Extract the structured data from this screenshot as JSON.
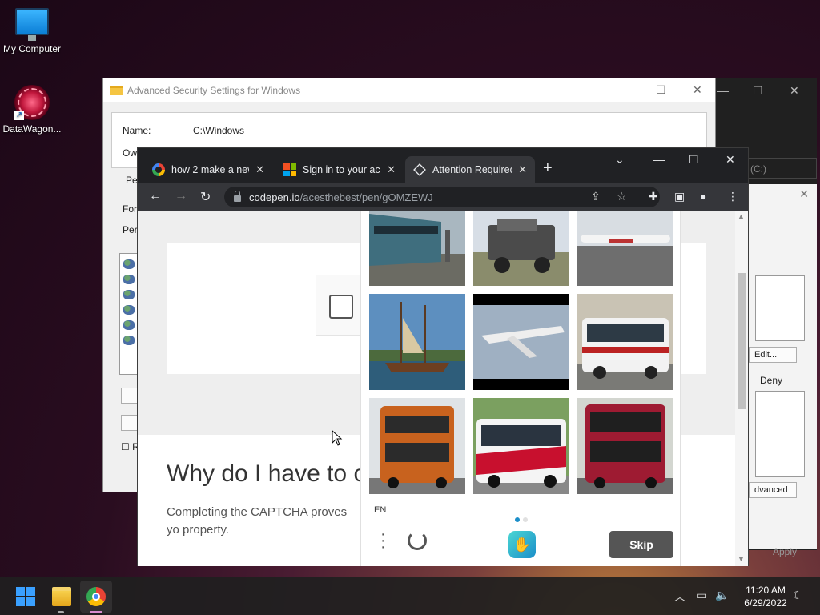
{
  "desktop": {
    "icons": [
      {
        "label": "My Computer"
      },
      {
        "label": "DataWagon..."
      }
    ]
  },
  "security_window": {
    "title": "Advanced Security Settings for Windows",
    "name_label": "Name:",
    "name_value": "C:\\Windows",
    "owner_label": "Ow",
    "tab_label": "Pe",
    "for_label": "For",
    "perm_label": "Perr",
    "checkbox_label": "R"
  },
  "back_window": {
    "drive": "(C:)",
    "edit_btn": "Edit...",
    "deny_label": "Deny",
    "advanced_btn": "dvanced",
    "apply_btn": "Apply"
  },
  "browser": {
    "tabs": [
      {
        "title": "how 2 make a new",
        "icon": "google-icon"
      },
      {
        "title": "Sign in to your acc",
        "icon": "microsoft-icon"
      },
      {
        "title": "Attention Required",
        "icon": "codepen-icon",
        "active": true
      }
    ],
    "url_host": "codepen.io",
    "url_path": "/acesthebest/pen/gOMZEWJ"
  },
  "page": {
    "heading": "Why do I have to c",
    "body": "Completing the CAPTCHA proves yo property."
  },
  "captcha": {
    "lang": "EN",
    "skip_label": "Skip",
    "tiles": [
      "train",
      "military-truck",
      "airplane",
      "sailing-ship",
      "airplane",
      "bus",
      "double-decker-bus",
      "bus",
      "double-decker-bus"
    ]
  },
  "taskbar": {
    "time": "11:20 AM",
    "date": "6/29/2022"
  },
  "colors": {
    "chrome_dark": "#202124",
    "chrome_toolbar": "#35363a",
    "skip_button": "#555555",
    "hcaptcha_accent": "#1b8ec9"
  }
}
